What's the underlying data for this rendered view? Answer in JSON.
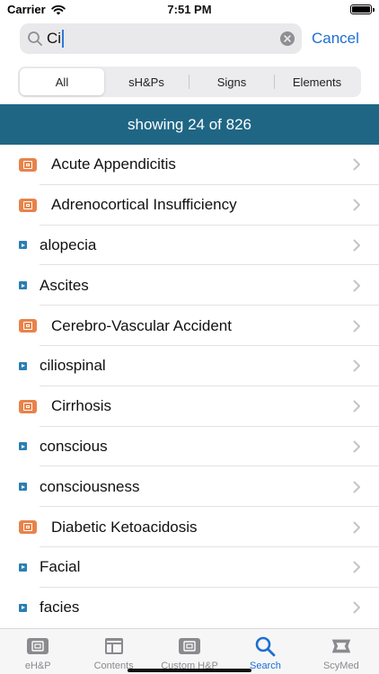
{
  "status_bar": {
    "carrier": "Carrier",
    "time": "7:51 PM"
  },
  "search": {
    "query": "Ci",
    "cancel_label": "Cancel"
  },
  "segments": [
    {
      "label": "All",
      "selected": true
    },
    {
      "label": "sH&Ps",
      "selected": false
    },
    {
      "label": "Signs",
      "selected": false
    },
    {
      "label": "Elements",
      "selected": false
    }
  ],
  "banner": {
    "text": "showing 24 of 826"
  },
  "results": [
    {
      "label": "Acute Appendicitis",
      "kind": "document-icon"
    },
    {
      "label": "Adrenocortical Insufficiency",
      "kind": "document-icon"
    },
    {
      "label": "alopecia",
      "kind": "sign-icon"
    },
    {
      "label": "Ascites",
      "kind": "sign-icon"
    },
    {
      "label": "Cerebro-Vascular Accident",
      "kind": "document-icon"
    },
    {
      "label": "ciliospinal",
      "kind": "sign-icon"
    },
    {
      "label": "Cirrhosis",
      "kind": "document-icon"
    },
    {
      "label": "conscious",
      "kind": "sign-icon"
    },
    {
      "label": "consciousness",
      "kind": "sign-icon"
    },
    {
      "label": "Diabetic Ketoacidosis",
      "kind": "document-icon"
    },
    {
      "label": "Facial",
      "kind": "sign-icon"
    },
    {
      "label": "facies",
      "kind": "sign-icon"
    }
  ],
  "tabs": [
    {
      "label": "eH&P",
      "icon": "ehp-icon",
      "active": false
    },
    {
      "label": "Contents",
      "icon": "contents-icon",
      "active": false
    },
    {
      "label": "Custom H&P",
      "icon": "custom-hp-icon",
      "active": false
    },
    {
      "label": "Search",
      "icon": "search-icon",
      "active": true
    },
    {
      "label": "ScyMed",
      "icon": "scymed-icon",
      "active": false
    }
  ],
  "colors": {
    "banner": "#1f6685",
    "accent": "#1e6fd1",
    "document_icon": "#e8834a",
    "sign_icon": "#2a7fb3"
  }
}
